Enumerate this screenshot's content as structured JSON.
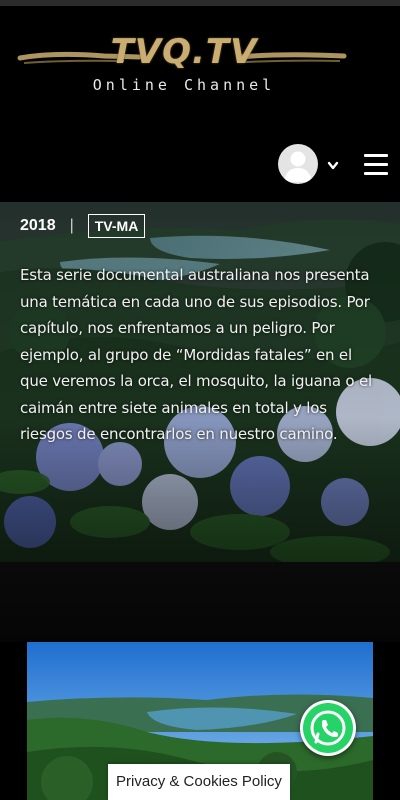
{
  "header": {
    "logo_title": "TVQ.TV",
    "logo_subtitle": "Online Channel",
    "account_avatar": "user-avatar",
    "account_dropdown_icon": "chevron-down-icon",
    "menu_icon": "hamburger-menu-icon"
  },
  "show": {
    "year": "2018",
    "separator": "|",
    "rating": "TV-MA",
    "description": "Esta serie documental australiana nos presenta una temática en cada uno de sus episodios. Por capítulo, nos enfrentamos a un peligro. Por ejemplo, al grupo de “Mordidas fatales” en el que veremos la orca, el mosquito, la iguana o el caimán entre siete animales en total y los riesgos de encontrarlos en nuestro camino."
  },
  "floating": {
    "whatsapp_icon": "whatsapp-icon",
    "privacy_label": "Privacy & Cookies Policy"
  },
  "colors": {
    "background": "#000000",
    "logo_gold": "#c9ad72",
    "text": "#ffffff",
    "whatsapp_green": "#25d366"
  }
}
